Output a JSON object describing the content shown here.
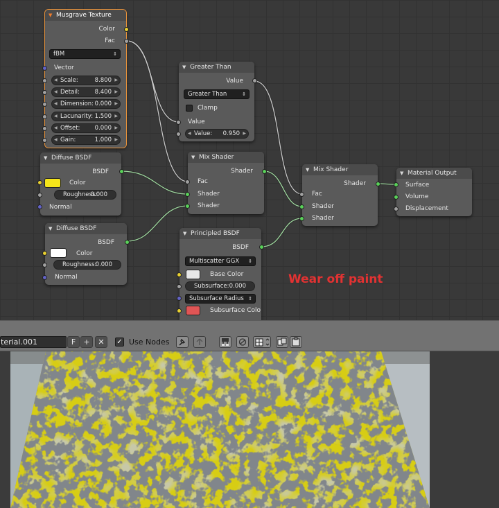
{
  "nodes": {
    "musgrave": {
      "title": "Musgrave Texture",
      "outputs": [
        "Color",
        "Fac"
      ],
      "type_value": "fBM",
      "vector_label": "Vector",
      "fields": [
        {
          "label": "Scale:",
          "value": "8.800"
        },
        {
          "label": "Detail:",
          "value": "8.400"
        },
        {
          "label": "Dimension:",
          "value": "0.000"
        },
        {
          "label": "Lacunarity:",
          "value": "1.500"
        },
        {
          "label": "Offset:",
          "value": "0.000"
        },
        {
          "label": "Gain:",
          "value": "1.000"
        }
      ]
    },
    "greater_than": {
      "title": "Greater Than",
      "output": "Value",
      "operation": "Greater Than",
      "clamp_label": "Clamp",
      "input_label": "Value",
      "field": {
        "label": "Value:",
        "value": "0.950"
      }
    },
    "diffuse1": {
      "title": "Diffuse BSDF",
      "output": "BSDF",
      "color_label": "Color",
      "color": "#f5e51a",
      "roughness": {
        "label": "Roughness:",
        "value": "0.000"
      },
      "normal_label": "Normal"
    },
    "diffuse2": {
      "title": "Diffuse BSDF",
      "output": "BSDF",
      "color_label": "Color",
      "color": "#ffffff",
      "roughness": {
        "label": "Roughness:",
        "value": "0.000"
      },
      "normal_label": "Normal"
    },
    "mix1": {
      "title": "Mix Shader",
      "output": "Shader",
      "inputs": [
        "Fac",
        "Shader",
        "Shader"
      ]
    },
    "mix2": {
      "title": "Mix Shader",
      "output": "Shader",
      "inputs": [
        "Fac",
        "Shader",
        "Shader"
      ]
    },
    "material_output": {
      "title": "Material Output",
      "inputs": [
        "Surface",
        "Volume",
        "Displacement"
      ]
    },
    "principled": {
      "title": "Principled BSDF",
      "output": "BSDF",
      "distribution": "Multiscatter GGX",
      "base_color_label": "Base Color",
      "base_color": "#e8e8e8",
      "subsurface": {
        "label": "Subsurface:",
        "value": "0.000"
      },
      "subsurface_radius": "Subsurface Radius",
      "subsurface_color_label": "Subsurface Colo",
      "subsurface_color": "#e05555"
    }
  },
  "annotation": "Wear off paint",
  "toolbar": {
    "material_name": "terial.001",
    "fake_user": "F",
    "add": "+",
    "remove": "✕",
    "use_nodes_label": "Use Nodes",
    "use_nodes_checked": "✓"
  },
  "colors": {
    "annotation": "#e23232",
    "paint_yellow": "#d7cd14",
    "socket_shader": "#59d159",
    "socket_color": "#e8d030",
    "socket_float": "#a1a1a1",
    "socket_vector": "#6363c7"
  },
  "icons": [
    "pin-icon",
    "parent-node-icon",
    "snap-icon",
    "snap-element-icon",
    "copy-nodes-icon",
    "paste-nodes-icon",
    "node-tree-icon"
  ]
}
